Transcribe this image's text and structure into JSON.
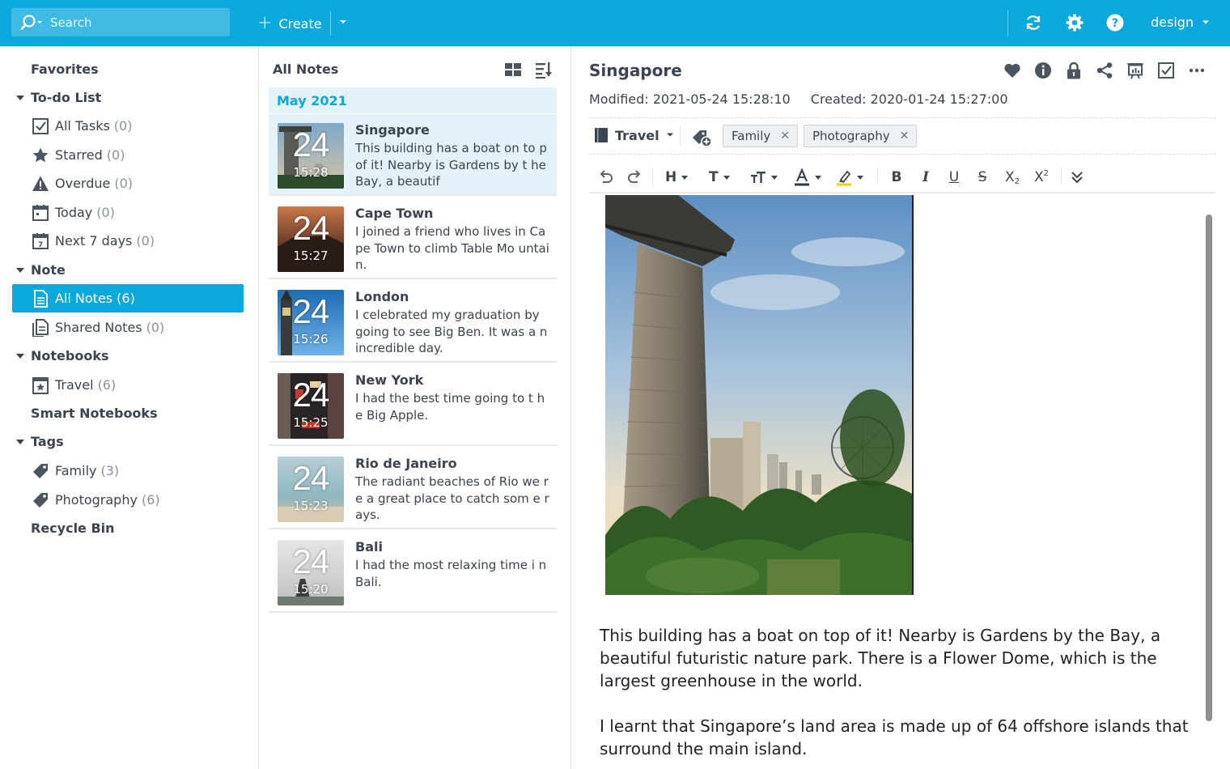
{
  "topbar": {
    "search_placeholder": "Search",
    "create_label": "Create",
    "user_label": "design",
    "accent": "#0aa8dc"
  },
  "sidebar": {
    "favorites": "Favorites",
    "todo": "To-do List",
    "todo_items": [
      {
        "label": "All Tasks",
        "count": "(0)",
        "icon": "checkbox-icon"
      },
      {
        "label": "Starred",
        "count": "(0)",
        "icon": "star-icon"
      },
      {
        "label": "Overdue",
        "count": "(0)",
        "icon": "warning-icon"
      },
      {
        "label": "Today",
        "count": "(0)",
        "icon": "calendar-icon"
      },
      {
        "label": "Next 7 days",
        "count": "(0)",
        "icon": "calendar-week-icon"
      }
    ],
    "note": "Note",
    "note_items": [
      {
        "label": "All Notes",
        "count": "(6)",
        "icon": "note-icon"
      },
      {
        "label": "Shared Notes",
        "count": "(0)",
        "icon": "shared-note-icon"
      }
    ],
    "notebooks": "Notebooks",
    "notebook_items": [
      {
        "label": "Travel",
        "count": "(6)",
        "icon": "notebook-star-icon"
      }
    ],
    "smart_notebooks": "Smart Notebooks",
    "tags": "Tags",
    "tag_items": [
      {
        "label": "Family",
        "count": "(3)",
        "icon": "tag-icon"
      },
      {
        "label": "Photography",
        "count": "(6)",
        "icon": "tag-icon"
      }
    ],
    "recycle_bin": "Recycle Bin"
  },
  "notelist": {
    "title": "All Notes",
    "month": "May 2021",
    "notes": [
      {
        "title": "Singapore",
        "snippet": "This building has a boat on to p of it! Nearby is Gardens by t he Bay, a beautif",
        "day": "24",
        "time": "15:28"
      },
      {
        "title": "Cape Town",
        "snippet": "I joined a friend who lives in Cape Town to climb Table Mo untain.",
        "day": "24",
        "time": "15:27"
      },
      {
        "title": "London",
        "snippet": "I celebrated my graduation by going to see Big Ben. It was a n incredible day.",
        "day": "24",
        "time": "15:26"
      },
      {
        "title": "New York",
        "snippet": "I had the best time going to t he Big Apple.",
        "day": "24",
        "time": "15:25"
      },
      {
        "title": "Rio de Janeiro",
        "snippet": "The radiant beaches of Rio we re a great place to catch som e rays.",
        "day": "24",
        "time": "15:23"
      },
      {
        "title": "Bali",
        "snippet": "I had the most relaxing time i n Bali.",
        "day": "24",
        "time": "15:20"
      }
    ]
  },
  "detail": {
    "title": "Singapore",
    "modified": "Modified: 2021-05-24 15:28:10",
    "created": "Created: 2020-01-24 15:27:00",
    "notebook": "Travel",
    "tags": [
      "Family",
      "Photography"
    ],
    "paragraphs": [
      "This building has a boat on top of it! Nearby is Gardens by the Bay, a beautiful futuristic nature park. There is a Flower Dome, which is the largest greenhouse in the world.",
      "I learnt that Singapore’s land area is made up of 64 offshore islands that surround the main island."
    ]
  }
}
